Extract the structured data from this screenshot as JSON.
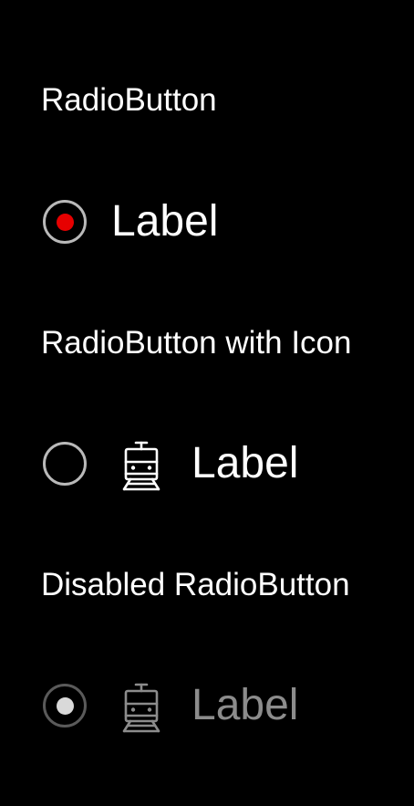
{
  "colors": {
    "background": "#000000",
    "text": "#ffffff",
    "disabled_text": "#8c8c8c",
    "radio_border": "#b9b9b9",
    "disabled_radio_border": "#5a5a5a",
    "accent": "#e60000",
    "disabled_dot": "#d9d9d9"
  },
  "sections": [
    {
      "title": "RadioButton",
      "radio": {
        "label": "Label",
        "checked": true,
        "disabled": false,
        "icon": null
      }
    },
    {
      "title": "RadioButton with Icon",
      "radio": {
        "label": "Label",
        "checked": false,
        "disabled": false,
        "icon": "train-icon"
      }
    },
    {
      "title": "Disabled RadioButton",
      "radio": {
        "label": "Label",
        "checked": true,
        "disabled": true,
        "icon": "train-icon"
      }
    }
  ]
}
